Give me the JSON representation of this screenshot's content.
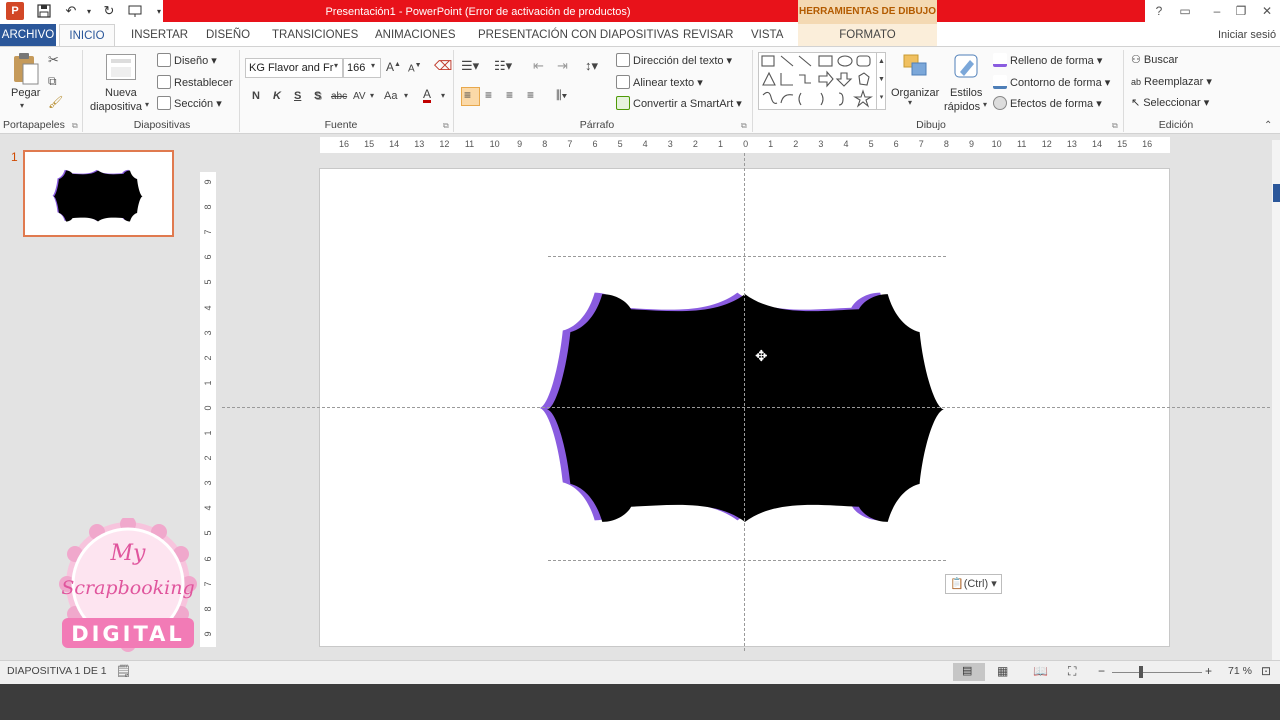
{
  "window": {
    "title": "Presentación1 -  PowerPoint (Error de activación de productos)",
    "context_group": "HERRAMIENTAS DE DIBUJO",
    "signin": "Iniciar sesió",
    "help": "?"
  },
  "tabs": [
    "ARCHIVO",
    "INICIO",
    "INSERTAR",
    "DISEÑO",
    "TRANSICIONES",
    "ANIMACIONES",
    "PRESENTACIÓN CON DIAPOSITIVAS",
    "REVISAR",
    "VISTA",
    "FORMATO"
  ],
  "ribbon": {
    "portapapeles": {
      "label": "Portapapeles",
      "paste": "Pegar"
    },
    "diapositivas": {
      "label": "Diapositivas",
      "new_slide_1": "Nueva",
      "new_slide_2": "diapositiva",
      "layout": "Diseño",
      "reset": "Restablecer",
      "section": "Sección"
    },
    "fuente": {
      "label": "Fuente",
      "font_name": "KG Flavor and Fr",
      "font_size": "166",
      "bold": "N",
      "italic": "K",
      "underline": "S",
      "shadow": "S",
      "strike": "abc",
      "spacing": "AV",
      "case": "Aa",
      "color": "A"
    },
    "parrafo": {
      "label": "Párrafo",
      "text_direction": "Dirección del texto",
      "align_text": "Alinear texto",
      "smartart": "Convertir a SmartArt"
    },
    "dibujo": {
      "label": "Dibujo",
      "arrange": "Organizar",
      "quick_styles_1": "Estilos",
      "quick_styles_2": "rápidos",
      "fill": "Relleno de forma",
      "outline": "Contorno de forma",
      "effects": "Efectos de forma"
    },
    "edicion": {
      "label": "Edición",
      "find": "Buscar",
      "replace": "Reemplazar",
      "select": "Seleccionar"
    }
  },
  "slides_pane": {
    "slide_number": "1"
  },
  "rulers": {
    "horizontal": [
      "16",
      "15",
      "14",
      "13",
      "12",
      "11",
      "10",
      "9",
      "8",
      "7",
      "6",
      "5",
      "4",
      "3",
      "2",
      "1",
      "0",
      "1",
      "2",
      "3",
      "4",
      "5",
      "6",
      "7",
      "8",
      "9",
      "10",
      "11",
      "12",
      "13",
      "14",
      "15",
      "16"
    ],
    "vertical": [
      "9",
      "8",
      "7",
      "6",
      "5",
      "4",
      "3",
      "2",
      "1",
      "0",
      "1",
      "2",
      "3",
      "4",
      "5",
      "6",
      "7",
      "8",
      "9"
    ]
  },
  "paste_options": "(Ctrl)",
  "status": {
    "slide_info": "DIAPOSITIVA 1 DE 1",
    "zoom": "71 %"
  },
  "watermark": {
    "line1": "My",
    "line2": "Scrapbooking",
    "line3": "DIGITAL"
  },
  "colors": {
    "accent": "#2b579a",
    "title_red": "#e8121a",
    "shape_fill": "#000000",
    "shape_shadow": "#8a5ce0",
    "drawing_tools": "#b35b00"
  }
}
